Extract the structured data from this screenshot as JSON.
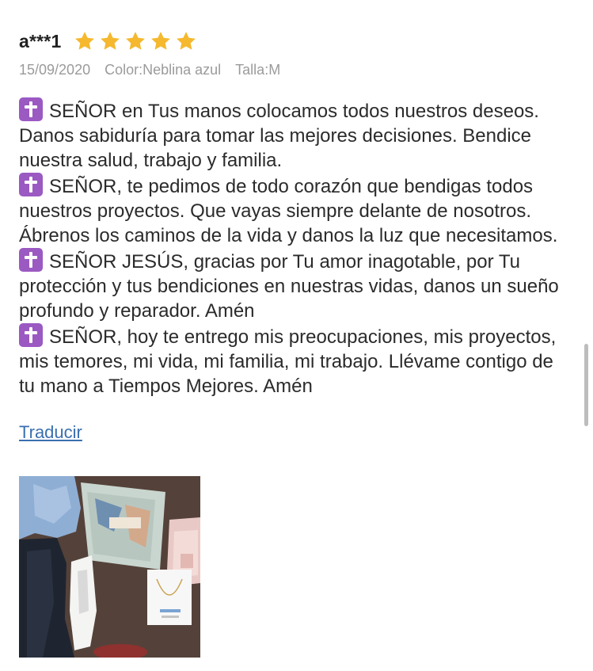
{
  "review": {
    "username": "a***1",
    "rating": 5,
    "rating_max": 5,
    "star_color": "#f5b82e",
    "date": "15/09/2020",
    "color": "Color:Neblina azul",
    "size": "Talla:M",
    "paragraphs": [
      "SEÑOR en Tus manos colocamos todos nuestros deseos. Danos sabiduría para tomar las mejores decisiones. Bendice nuestra salud, trabajo y familia.",
      "SEÑOR, te pedimos de todo corazón que bendigas todos nuestros proyectos. Que vayas siempre delante de nosotros. Ábrenos los caminos de la vida y danos la luz que necesitamos.",
      "SEÑOR JESÚS, gracias por Tu amor inagotable, por Tu protección y tus bendiciones en nuestras vidas, danos un sueño profundo y reparador. Amén",
      "SEÑOR, hoy te entrego mis preocupaciones, mis proyectos, mis temores, mi vida, mi familia, mi trabajo. Llévame contigo de tu mano a Tiempos Mejores. Amén"
    ],
    "paragraph_icon": "latin-cross-emoji-icon",
    "translate_label": "Traducir",
    "link_color": "#3a6fb0",
    "photo": {
      "alt_icon": "review-photo"
    }
  }
}
